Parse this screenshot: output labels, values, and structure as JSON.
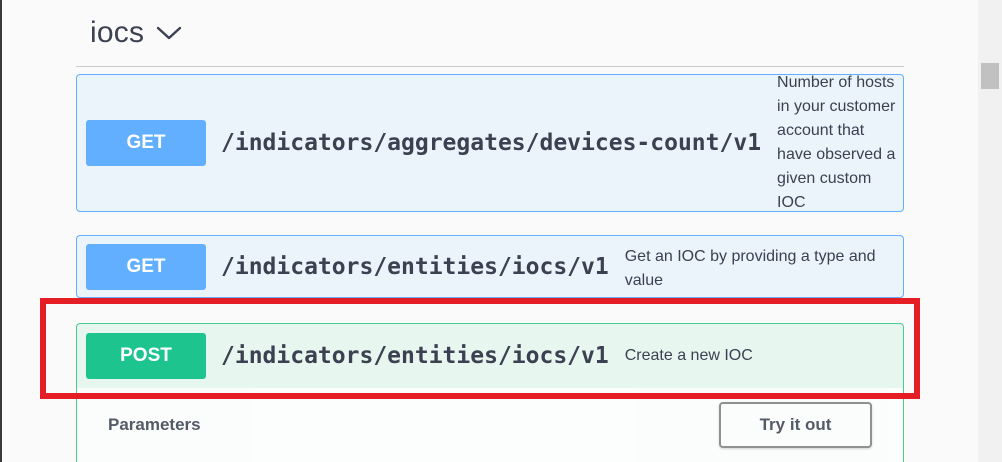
{
  "tag": {
    "title": "iocs",
    "chevron_icon": "chevron-down-icon"
  },
  "operations": [
    {
      "method": "GET",
      "path": "/indicators/aggregates/devices-count/v1",
      "summary": "Number of hosts in your customer account that have observed a given custom IOC"
    },
    {
      "method": "GET",
      "path": "/indicators/entities/iocs/v1",
      "summary": "Get an IOC by providing a type and value"
    },
    {
      "method": "POST",
      "path": "/indicators/entities/iocs/v1",
      "summary": "Create a new IOC"
    }
  ],
  "expanded": {
    "parameters_label": "Parameters",
    "try_button_label": "Try it out"
  },
  "colors": {
    "get": "#61affe",
    "post": "#49cc90",
    "highlight": "#e51e25"
  }
}
